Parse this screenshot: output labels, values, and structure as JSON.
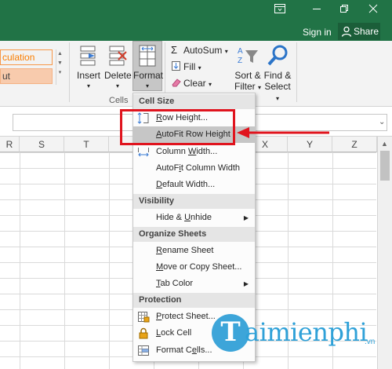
{
  "window": {
    "controls": [
      "▣",
      "–",
      "❐",
      "✕"
    ],
    "sign_in": "Sign in",
    "share": "Share"
  },
  "ribbon": {
    "styles": {
      "calculation": "culation",
      "output": "ut"
    },
    "cells_group": {
      "insert": "Insert",
      "delete": "Delete",
      "format": "Format",
      "label": "Cells"
    },
    "editing_group": {
      "autosum": "AutoSum",
      "fill": "Fill",
      "clear": "Clear",
      "sort_filter_line1": "Sort &",
      "sort_filter_line2": "Filter",
      "find_select_line1": "Find &",
      "find_select_line2": "Select"
    }
  },
  "grid": {
    "columns": [
      "R",
      "S",
      "T",
      "X",
      "Y",
      "Z"
    ]
  },
  "format_menu": {
    "sections": {
      "cell_size": "Cell Size",
      "visibility": "Visibility",
      "organize_sheets": "Organize Sheets",
      "protection": "Protection"
    },
    "items": {
      "row_height": {
        "pre": "",
        "key": "R",
        "post": "ow Height..."
      },
      "autofit_row_height": {
        "pre": "",
        "key": "A",
        "post": "utoFit Row Height"
      },
      "column_width": {
        "pre": "Column ",
        "key": "W",
        "post": "idth..."
      },
      "autofit_column_width": {
        "pre": "AutoF",
        "key": "i",
        "post": "t Column Width"
      },
      "default_width": {
        "pre": "",
        "key": "D",
        "post": "efault Width..."
      },
      "hide_unhide": {
        "pre": "Hide & ",
        "key": "U",
        "post": "nhide"
      },
      "rename_sheet": {
        "pre": "",
        "key": "R",
        "post": "ename Sheet"
      },
      "move_copy_sheet": {
        "pre": "",
        "key": "M",
        "post": "ove or Copy Sheet..."
      },
      "tab_color": {
        "pre": "",
        "key": "T",
        "post": "ab Color"
      },
      "protect_sheet": {
        "pre": "",
        "key": "P",
        "post": "rotect Sheet..."
      },
      "lock_cell": {
        "pre": "",
        "key": "L",
        "post": "ock Cell"
      },
      "format_cells": {
        "pre": "Format C",
        "key": "e",
        "post": "lls..."
      }
    }
  },
  "watermark": {
    "letter": "T",
    "text": "aimienphi",
    "suffix": ".vn"
  },
  "colors": {
    "excel_green": "#217346",
    "annotation_red": "#e0141e",
    "menu_highlight": "#c6c6c6"
  }
}
